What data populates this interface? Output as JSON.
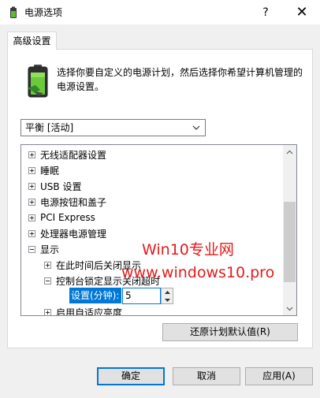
{
  "window": {
    "title": "电源选项",
    "help_glyph": "?",
    "close_glyph": "✕"
  },
  "tab": {
    "label": "高级设置"
  },
  "description": "选择你要自定义的电源计划，然后选择你希望计算机管理的电源设置。",
  "plan_select": {
    "value": "平衡 [活动]"
  },
  "tree": {
    "items": [
      {
        "label": "无线适配器设置",
        "expander": "plus",
        "level": 0
      },
      {
        "label": "睡眠",
        "expander": "plus",
        "level": 0
      },
      {
        "label": "USB 设置",
        "expander": "plus",
        "level": 0
      },
      {
        "label": "电源按钮和盖子",
        "expander": "plus",
        "level": 0
      },
      {
        "label": "PCI Express",
        "expander": "plus",
        "level": 0
      },
      {
        "label": "处理器电源管理",
        "expander": "plus",
        "level": 0
      },
      {
        "label": "显示",
        "expander": "minus",
        "level": 0
      },
      {
        "label": "在此时间后关闭显示",
        "expander": "plus",
        "level": 1
      },
      {
        "label": "控制台锁定显示关闭超时",
        "expander": "minus",
        "level": 1
      },
      {
        "label": "启用自适应亮度",
        "expander": "plus",
        "level": 1
      }
    ],
    "setting": {
      "label": "设置(分钟):",
      "value": "5"
    }
  },
  "watermark": {
    "line1": "Win10专业网",
    "line2": "www.windows10.pro"
  },
  "buttons": {
    "restore": "还原计划默认值(R)",
    "ok": "确定",
    "cancel": "取消",
    "apply": "应用(A)"
  },
  "colors": {
    "accent": "#0078d7",
    "watermark": "#e31b1b"
  }
}
